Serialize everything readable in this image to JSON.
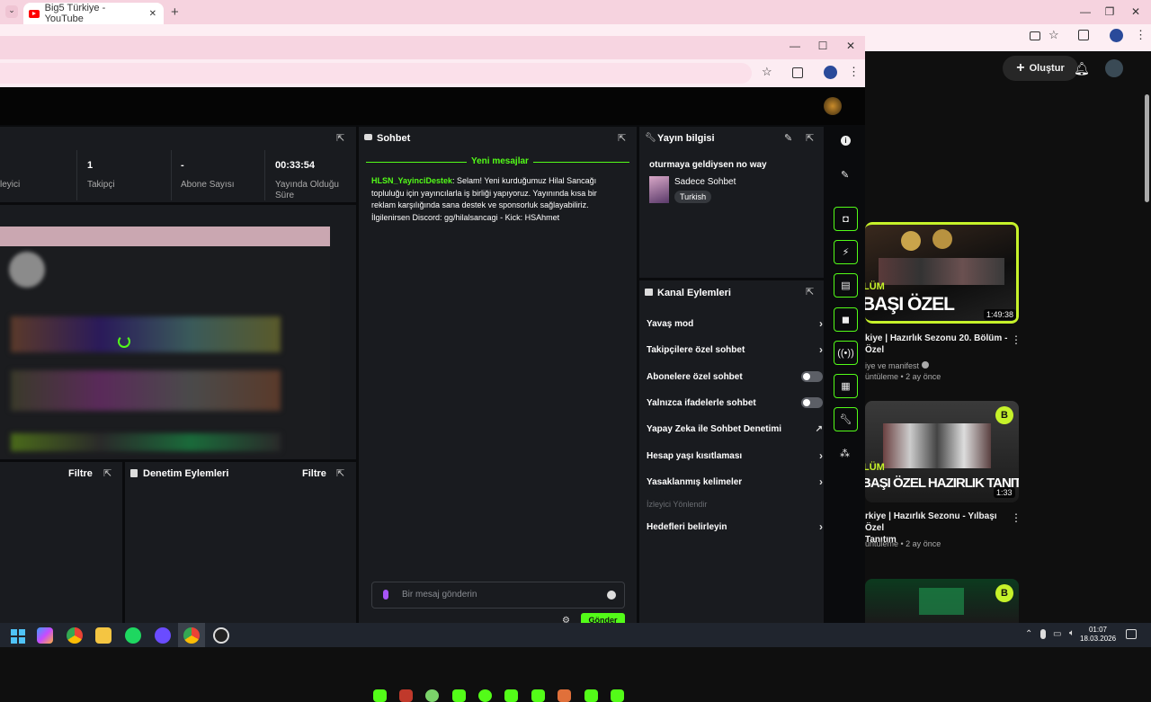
{
  "back_browser": {
    "tab_title": "Big5 Türkiye - YouTube",
    "new_tab": "+",
    "controls": {
      "minimize": "—",
      "restore": "❐",
      "close": "✕"
    }
  },
  "yt": {
    "create_label": "Oluştur",
    "videos": [
      {
        "title_line1": "kiye | Hazırlık Sezonu 20. Bölüm -",
        "title_line2": "Özel",
        "channel": "iye ve manifest",
        "meta": "üntüleme • 2 ay önce",
        "duration": "1:49:38",
        "thumb_text": "BAŞI ÖZEL",
        "thumb_small": "LÜM"
      },
      {
        "title_line1": "rkiye | Hazırlık Sezonu - Yılbaşı Özel",
        "title_line2": "Tanıtım",
        "channel": "",
        "meta": "üntüleme • 2 ay önce",
        "duration": "1:33",
        "thumb_text": "BAŞI ÖZEL HAZIRLIK TANITIM",
        "thumb_small": "LÜM"
      }
    ],
    "badge": "B"
  },
  "front": {
    "controls": {
      "minimize": "—",
      "maximize": "☐",
      "close": "✕"
    }
  },
  "stats": [
    {
      "value": "",
      "label": "leyici"
    },
    {
      "value": "1",
      "label": "Takipçi"
    },
    {
      "value": "-",
      "label": "Abone Sayısı"
    },
    {
      "value": "00:33:54",
      "label": "Yayında Olduğu Süre"
    }
  ],
  "panels": {
    "filter_left": "Filtre",
    "moderation_title": "Denetim Eylemleri",
    "filter_right": "Filtre"
  },
  "chat": {
    "title": "Sohbet",
    "new_messages": "Yeni mesajlar",
    "message_user": "HLSN_YayinciDestek",
    "message_text": ": Selam! Yeni kurduğumuz Hilal Sancağı topluluğu için yayıncılarla iş birliği yapıyoruz. Yayınında kısa bir reklam karşılığında sana destek ve sponsorluk sağlayabiliriz. İlgilenirsen Discord: gg/hilalsancagi - Kick: HSAhmet",
    "input_placeholder": "Bir mesaj gönderin",
    "send_label": "Gönder"
  },
  "stream_info": {
    "title": "Yayın bilgisi",
    "stream_title": "oturmaya geldiysen no way",
    "category": "Sadece Sohbet",
    "language": "Turkish"
  },
  "channel_actions": {
    "title": "Kanal Eylemleri",
    "items": [
      {
        "label": "Yavaş mod",
        "control": "chevron"
      },
      {
        "label": "Takipçilere özel sohbet",
        "control": "chevron"
      },
      {
        "label": "Abonelere özel sohbet",
        "control": "toggle"
      },
      {
        "label": "Yalnızca ifadelerle sohbet",
        "control": "toggle"
      },
      {
        "label": "Yapay Zeka ile Sohbet Denetimi",
        "control": "external"
      },
      {
        "label": "Hesap yaşı kısıtlaması",
        "control": "chevron"
      },
      {
        "label": "Yasaklanmış kelimeler",
        "control": "chevron"
      }
    ],
    "section_label": "İzleyici Yönlendir",
    "goals_label": "Hedefleri belirleyin"
  },
  "taskbar": {
    "time": "01:07",
    "date": "18.03.2026"
  },
  "colors": {
    "accent": "#53fc18",
    "panel": "#191b1f",
    "background": "#0a0b0d"
  }
}
